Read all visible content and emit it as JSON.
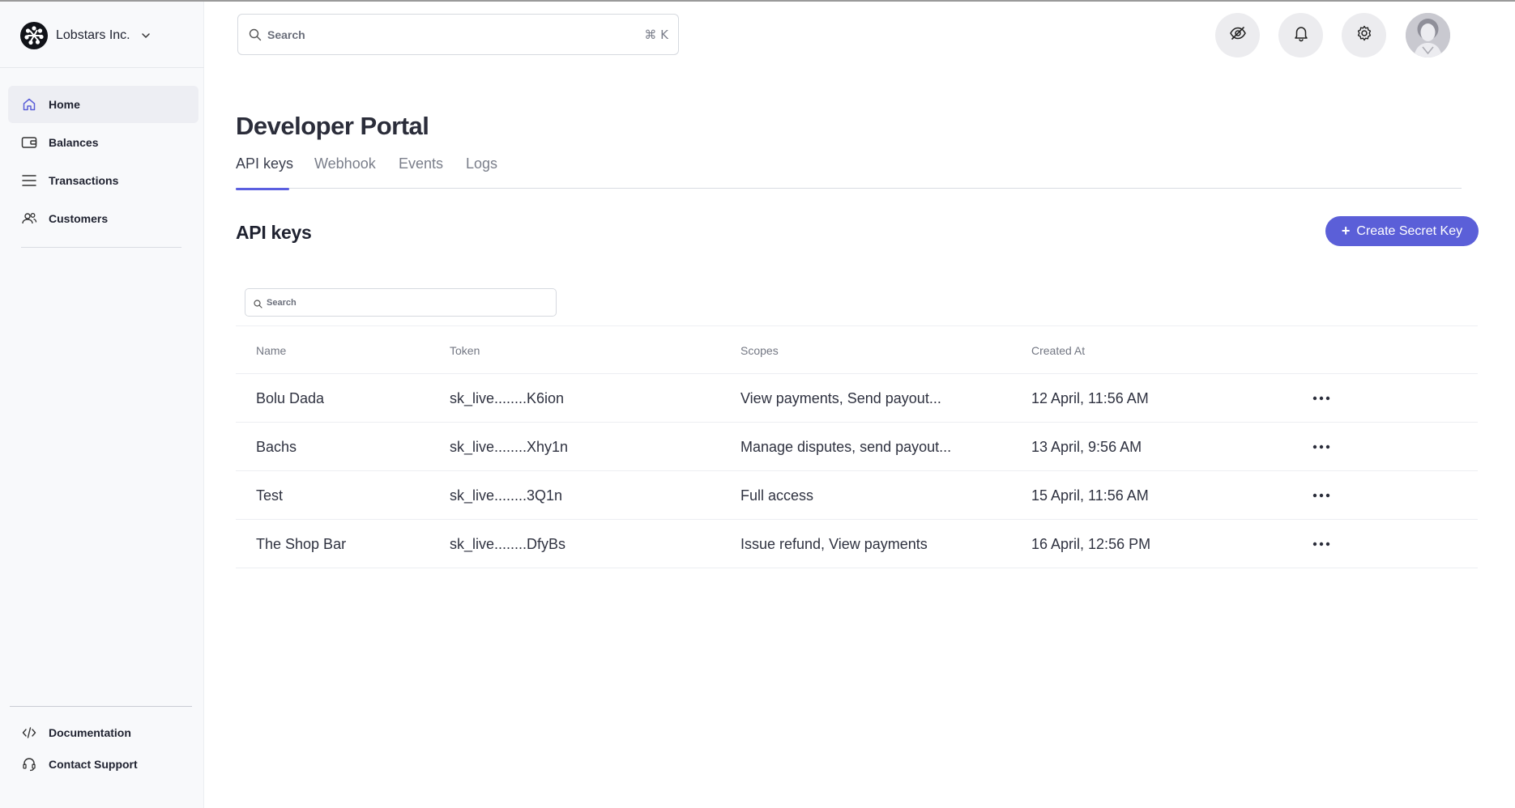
{
  "brand": {
    "name": "Lobstars Inc."
  },
  "sidebar": {
    "items": [
      {
        "label": "Home",
        "icon": "home-icon",
        "active": true
      },
      {
        "label": "Balances",
        "icon": "wallet-icon",
        "active": false
      },
      {
        "label": "Transactions",
        "icon": "list-icon",
        "active": false
      },
      {
        "label": "Customers",
        "icon": "users-icon",
        "active": false
      }
    ],
    "bottom": [
      {
        "label": "Documentation",
        "icon": "code-icon"
      },
      {
        "label": "Contact Support",
        "icon": "headset-icon"
      }
    ]
  },
  "topbar": {
    "search_placeholder": "Search",
    "shortcut": "⌘ K",
    "buttons": [
      "eye-off-icon",
      "bell-icon",
      "gear-icon"
    ]
  },
  "page": {
    "title": "Developer Portal",
    "tabs": [
      {
        "label": "API keys",
        "active": true
      },
      {
        "label": "Webhook",
        "active": false
      },
      {
        "label": "Events",
        "active": false
      },
      {
        "label": "Logs",
        "active": false
      }
    ]
  },
  "api_keys": {
    "title": "API keys",
    "create_label": "Create Secret Key",
    "search_placeholder": "Search",
    "columns": [
      "Name",
      "Token",
      "Scopes",
      "Created At"
    ],
    "rows": [
      {
        "name": "Bolu Dada",
        "token": "sk_live........K6ion",
        "scopes": "View payments, Send payout...",
        "created": "12 April, 11:56 AM"
      },
      {
        "name": "Bachs",
        "token": "sk_live........Xhy1n",
        "scopes": "Manage disputes, send payout...",
        "created": "13 April, 9:56 AM"
      },
      {
        "name": "Test",
        "token": "sk_live........3Q1n",
        "scopes": "Full access",
        "created": "15 April, 11:56 AM"
      },
      {
        "name": "The Shop Bar",
        "token": "sk_live........DfyBs",
        "scopes": "Issue refund, View payments",
        "created": "16 April, 12:56 PM"
      }
    ]
  },
  "colors": {
    "accent": "#5b5fd8",
    "sidebar_bg": "#f8f9fb",
    "active_nav_bg": "#edeef3"
  }
}
